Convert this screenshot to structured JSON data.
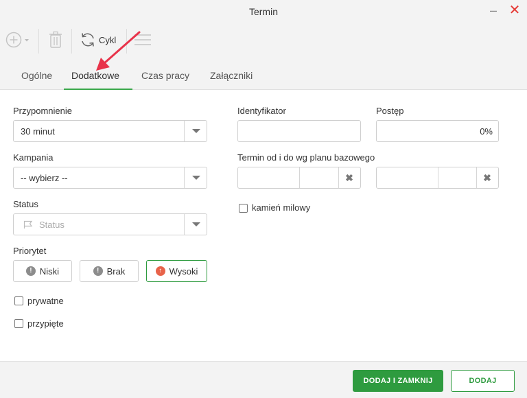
{
  "window": {
    "title": "Termin",
    "minimize_glyph": "–",
    "close_glyph": "✕"
  },
  "toolbar": {
    "cycle_label": "Cykl",
    "icons": [
      "add-icon",
      "dropdown-caret-icon",
      "trash-icon",
      "cycle-icon",
      "menu-lines-icon"
    ]
  },
  "tabs": [
    {
      "label": "Ogólne",
      "active": false
    },
    {
      "label": "Dodatkowe",
      "active": true
    },
    {
      "label": "Czas pracy",
      "active": false
    },
    {
      "label": "Załączniki",
      "active": false
    }
  ],
  "form": {
    "reminder": {
      "label": "Przypomnienie",
      "value": "30 minut"
    },
    "campaign": {
      "label": "Kampania",
      "value": "-- wybierz --"
    },
    "status": {
      "label": "Status",
      "placeholder": "Status"
    },
    "priority": {
      "label": "Priorytet",
      "options": [
        {
          "label": "Niski",
          "selected": false
        },
        {
          "label": "Brak",
          "selected": false
        },
        {
          "label": "Wysoki",
          "selected": true
        }
      ]
    },
    "private": {
      "label": "prywatne",
      "checked": false
    },
    "pinned": {
      "label": "przypięte",
      "checked": false
    },
    "identifier": {
      "label": "Identyfikator",
      "value": ""
    },
    "progress": {
      "label": "Postęp",
      "value": "0%"
    },
    "baseline_range": {
      "label": "Termin od i do wg planu bazowego"
    },
    "milestone": {
      "label": "kamień milowy",
      "checked": false
    }
  },
  "footer": {
    "add_close_label": "DODAJ I ZAMKNIJ",
    "add_label": "DODAJ"
  },
  "colors": {
    "accent": "#2e9b3f",
    "close": "#e53935",
    "arrow": "#e8334a",
    "high_priority": "#e8634a"
  }
}
